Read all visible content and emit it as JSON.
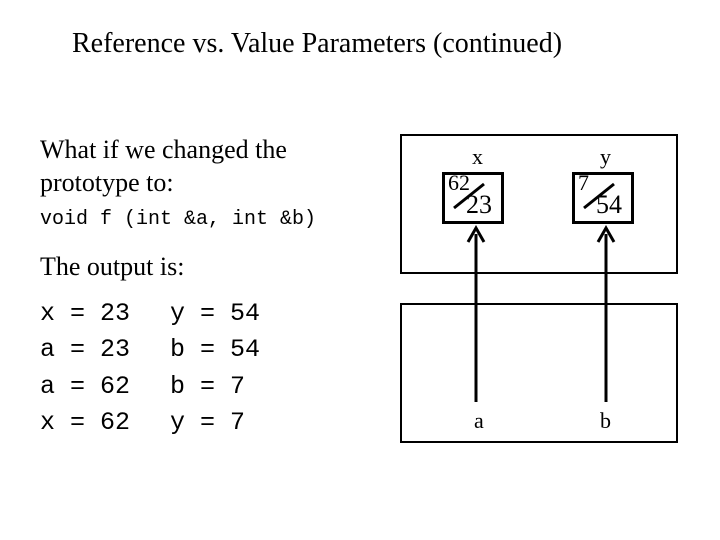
{
  "title": "Reference vs. Value Parameters (continued)",
  "intro_line1": "What if we changed the",
  "intro_line2": "prototype to:",
  "prototype": "void f (int &a, int &b)",
  "output_header": "The output is:",
  "output_rows": [
    {
      "c1": "x = 23",
      "c2": "y = 54"
    },
    {
      "c1": "a = 23",
      "c2": "b = 54"
    },
    {
      "c1": "a = 62",
      "c2": "b = 7"
    },
    {
      "c1": "x = 62",
      "c2": "y = 7"
    }
  ],
  "diagram": {
    "vars": {
      "x": "x",
      "y": "y",
      "a": "a",
      "b": "b"
    },
    "x_old": "62",
    "x_new": "23",
    "y_old": "7",
    "y_new": "54"
  }
}
